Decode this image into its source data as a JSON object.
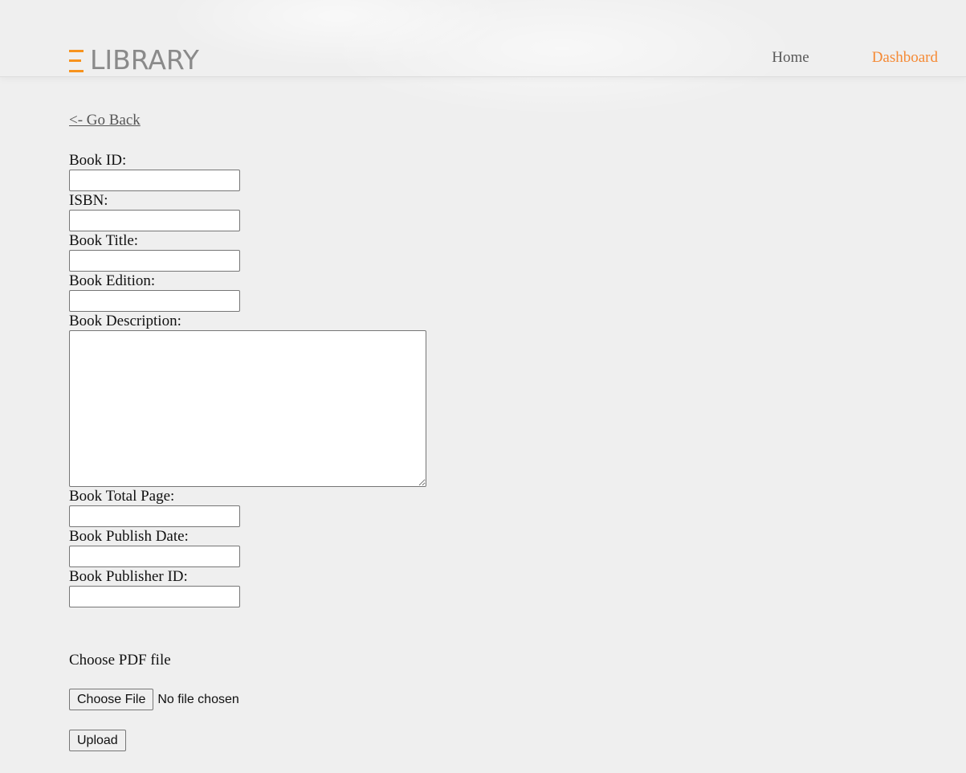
{
  "header": {
    "logo_text": "LIBRARY",
    "accent_color": "#f7931e",
    "nav": {
      "home": "Home",
      "dashboard": "Dashboard"
    }
  },
  "go_back": "<- Go Back",
  "form": {
    "book_id_label": "Book ID:",
    "isbn_label": "ISBN:",
    "title_label": "Book Title:",
    "edition_label": "Book Edition:",
    "description_label": "Book Description:",
    "total_page_label": "Book Total Page:",
    "publish_date_label": "Book Publish Date:",
    "publisher_id_label": "Book Publisher ID:"
  },
  "upload": {
    "pdf_label": "Choose PDF file",
    "choose_button": "Choose File",
    "file_status": "No file chosen",
    "upload_button": "Upload"
  }
}
